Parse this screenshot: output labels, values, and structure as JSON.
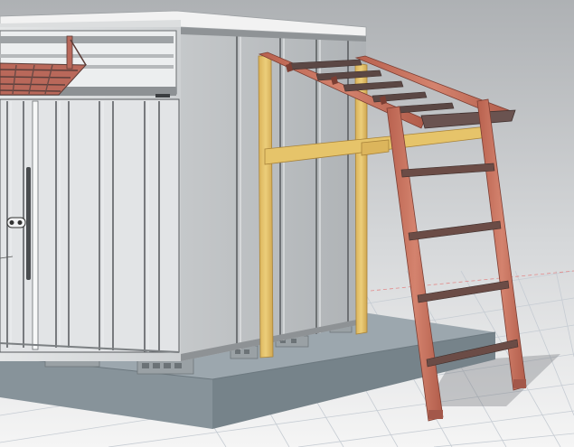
{
  "scene": {
    "subject": "3d-cad-render-storage-shed-with-lean-to-frame-and-ladder",
    "colors": {
      "background_top": "#b9bcbf",
      "background_bottom": "#f4f4f4",
      "grid_line": "#c9cfd6",
      "concrete_slab_top": "#9aa5ac",
      "concrete_slab_side": "#7e8a91",
      "shed_panel": "#d3d6d8",
      "shed_panel_dark": "#a9adb0",
      "yellow_timber": "#e2bf62",
      "red_timber": "#c77460",
      "ladder_rung": "#6b4c46",
      "rafter_dark": "#5a4643"
    }
  }
}
